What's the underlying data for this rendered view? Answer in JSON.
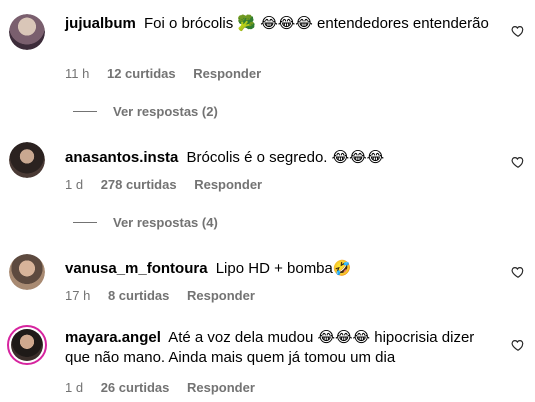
{
  "comments": [
    {
      "username": "jujualbum",
      "text_parts": [
        "Foi o brócolis ",
        "🥦",
        " ",
        "😂😂😂",
        " entendedores entenderão"
      ],
      "time": "11 h",
      "likes": "12 curtidas",
      "reply": "Responder",
      "view_replies": "Ver respostas (2)"
    },
    {
      "username": "anasantos.insta",
      "text_parts": [
        "Brócolis é o segredo. ",
        "😂😂😂"
      ],
      "time": "1 d",
      "likes": "278 curtidas",
      "reply": "Responder",
      "view_replies": "Ver respostas (4)"
    },
    {
      "username": "vanusa_m_fontoura",
      "text_parts": [
        "Lipo HD + bomba",
        "🤣"
      ],
      "time": "17 h",
      "likes": "8 curtidas",
      "reply": "Responder"
    },
    {
      "username": "mayara.angel",
      "text_parts": [
        "Até a voz dela mudou ",
        "😂😂😂",
        " hipocrisia dizer que não mano. Ainda mais quem já tomou um dia"
      ],
      "time": "1 d",
      "likes": "26 curtidas",
      "reply": "Responder"
    }
  ],
  "colors": {
    "meta": "#737373",
    "story_ring": "#d6249f"
  },
  "icons": {
    "like": "heart-outline-icon"
  }
}
